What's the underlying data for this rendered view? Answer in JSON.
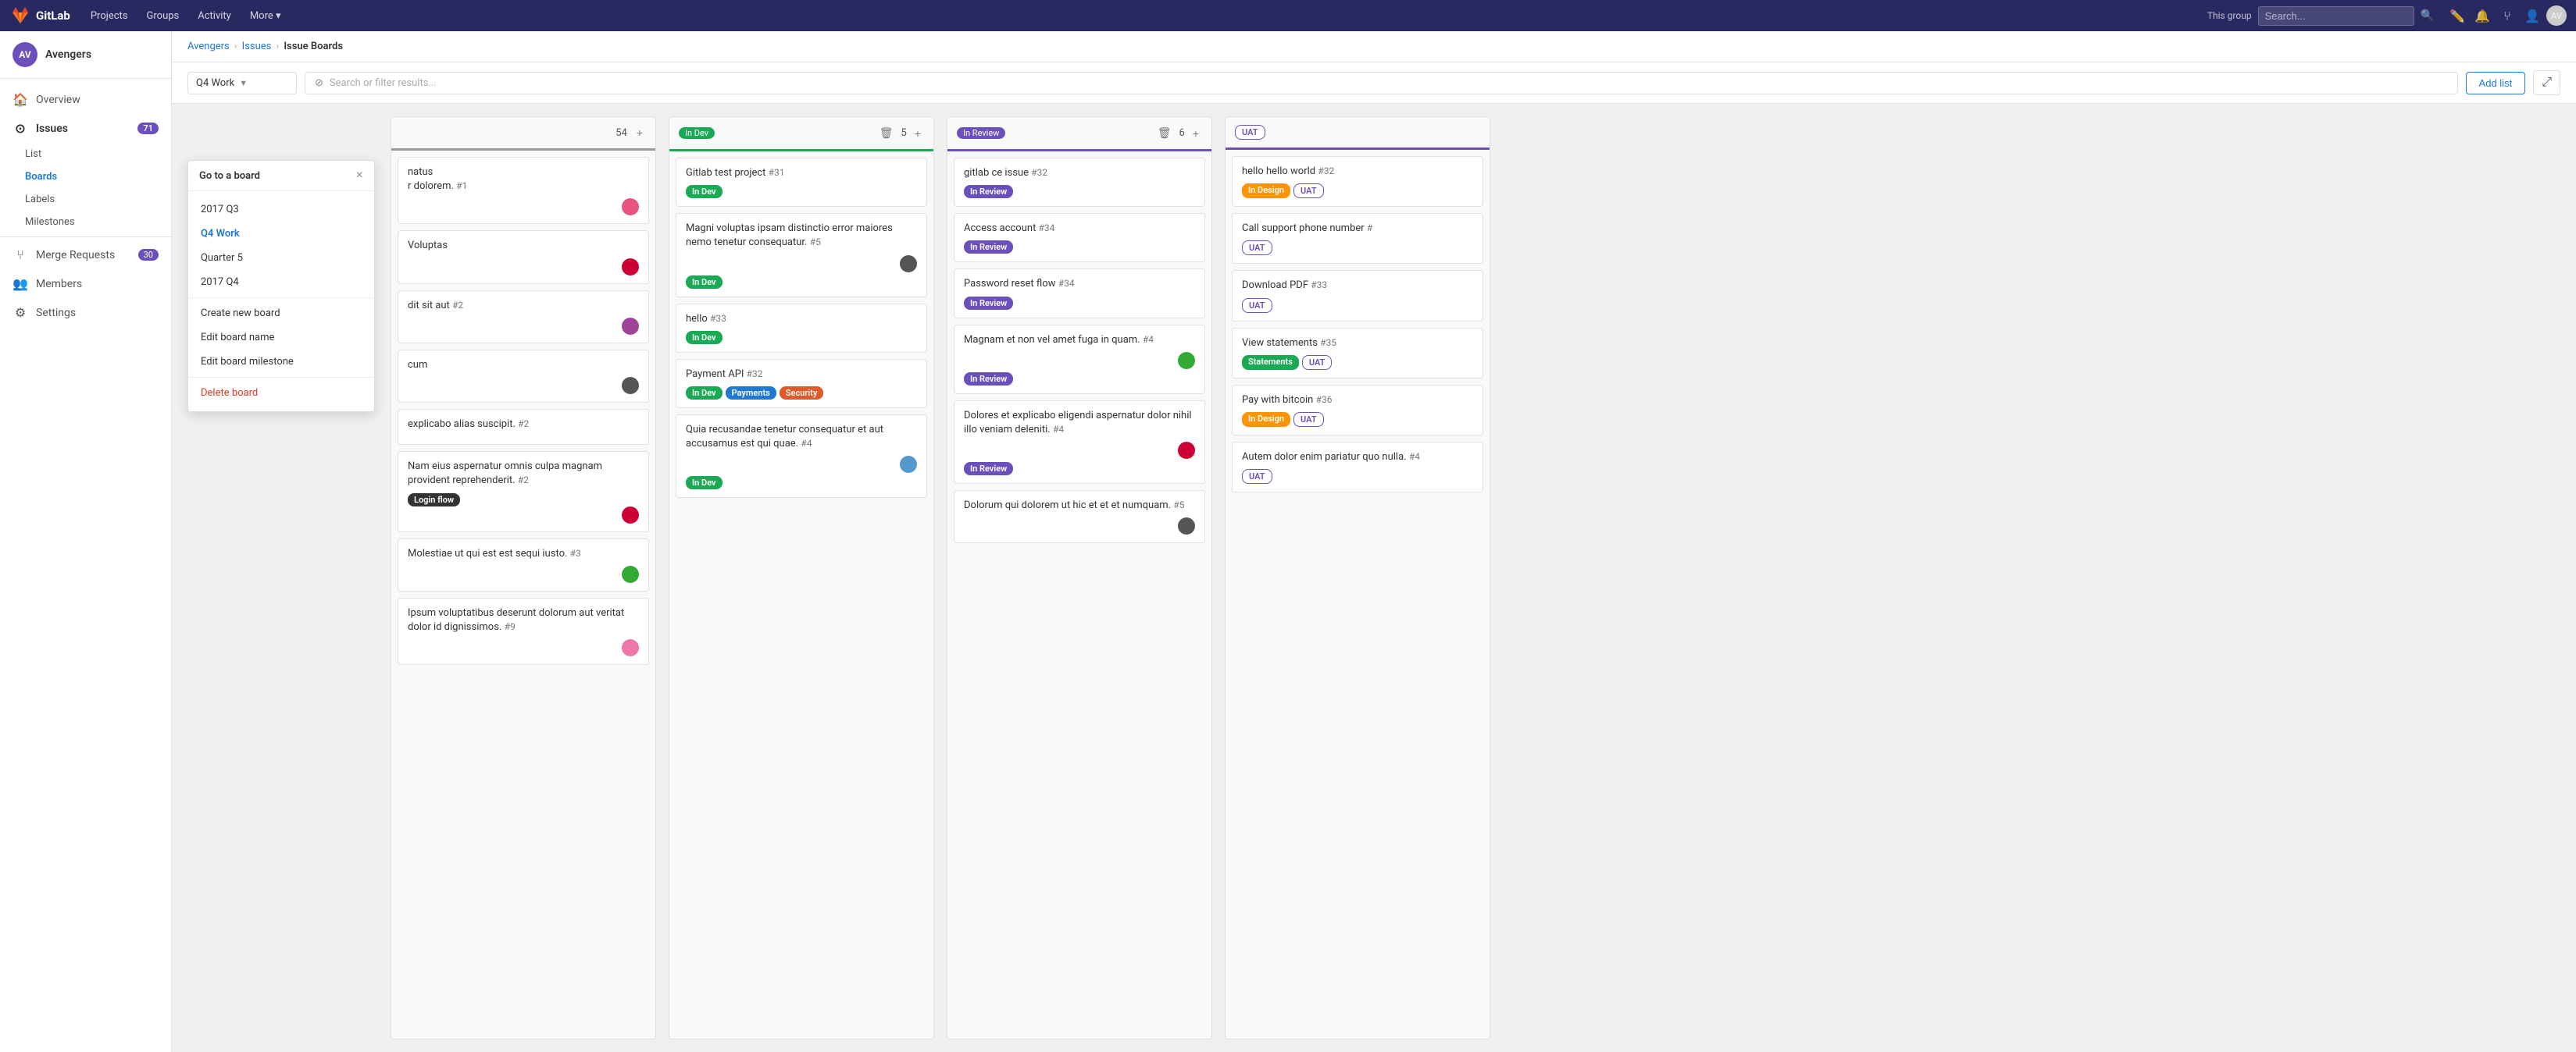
{
  "topNav": {
    "logoText": "GitLab",
    "links": [
      "Projects",
      "Groups",
      "Activity",
      "More ▾"
    ],
    "searchPlaceholder": "This group   Search...",
    "groupLabel": "This group"
  },
  "sidebar": {
    "groupName": "Avengers",
    "avatarInitials": "AV",
    "items": [
      {
        "id": "overview",
        "label": "Overview",
        "icon": "🏠",
        "badge": null
      },
      {
        "id": "issues",
        "label": "Issues",
        "icon": "⊙",
        "badge": "71"
      },
      {
        "id": "list",
        "label": "List",
        "icon": null,
        "sub": true
      },
      {
        "id": "boards",
        "label": "Boards",
        "icon": null,
        "sub": true,
        "active": true
      },
      {
        "id": "labels",
        "label": "Labels",
        "icon": null,
        "sub": true
      },
      {
        "id": "milestones",
        "label": "Milestones",
        "icon": null,
        "sub": true
      },
      {
        "id": "merge-requests",
        "label": "Merge Requests",
        "icon": "⑂",
        "badge": "30"
      },
      {
        "id": "members",
        "label": "Members",
        "icon": "👥",
        "badge": null
      },
      {
        "id": "settings",
        "label": "Settings",
        "icon": "⚙",
        "badge": null
      }
    ]
  },
  "breadcrumb": {
    "items": [
      "Avengers",
      "Issues",
      "Issue Boards"
    ]
  },
  "toolbar": {
    "boardSelect": "Q4 Work",
    "filterPlaceholder": "Search or filter results...",
    "addListLabel": "Add list",
    "fullscreenIcon": "⤢"
  },
  "dropdown": {
    "title": "Go to a board",
    "boards": [
      "2017 Q3",
      "Q4 Work",
      "Quarter 5",
      "2017 Q4"
    ],
    "activeBoard": "Q4 Work",
    "actions": [
      "Create new board",
      "Edit board name",
      "Edit board milestone",
      "Delete board"
    ]
  },
  "columns": [
    {
      "id": "partial",
      "label": "",
      "count": 54,
      "badgeType": "none",
      "cards": [
        {
          "title": "natus\nr dolorem.",
          "number": "#1",
          "labels": [],
          "avatarColor": "#e75480"
        },
        {
          "title": "Voluptas",
          "number": "",
          "labels": [],
          "avatarColor": "#e03"
        },
        {
          "title": "dit sit aut",
          "number": "#2",
          "labels": [],
          "avatarColor": "#a04"
        },
        {
          "title": "cum",
          "number": "",
          "labels": [],
          "avatarColor": "#555"
        },
        {
          "title": "explicabo alias suscipit.",
          "number": "#2",
          "labels": [],
          "avatarColor": null
        },
        {
          "title": "Nam eius aspernatur omnis culpa magnam provident reprehenderit.",
          "number": "#2",
          "labels": [
            "Login flow"
          ],
          "avatarColor": "#e03"
        },
        {
          "title": "Molestiae ut qui est est sequi iusto.",
          "number": "#3",
          "labels": [],
          "avatarColor": "#3a3"
        },
        {
          "title": "Ipsum voluptatibus deserunt dolorum aut veritat dolor id dignissimos.",
          "number": "#9",
          "labels": [],
          "avatarColor": "#e75"
        }
      ]
    },
    {
      "id": "in-dev",
      "label": "In Dev",
      "count": 5,
      "badgeType": "green",
      "cards": [
        {
          "title": "Gitlab test project",
          "number": "#31",
          "labels": [
            "In Dev"
          ],
          "avatarColor": null
        },
        {
          "title": "Magni voluptas ipsam distinctio error maiores nemo tenetur consequatur.",
          "number": "#5",
          "labels": [
            "In Dev"
          ],
          "avatarColor": "#555"
        },
        {
          "title": "hello",
          "number": "#33",
          "labels": [
            "In Dev"
          ],
          "avatarColor": null
        },
        {
          "title": "Payment API",
          "number": "#32",
          "labels": [
            "In Dev",
            "Payments",
            "Security"
          ],
          "avatarColor": null
        },
        {
          "title": "Quia recusandae tenetur consequatur et aut accusamus est qui quae.",
          "number": "#4",
          "labels": [
            "In Dev"
          ],
          "avatarColor": "#55a"
        }
      ]
    },
    {
      "id": "in-review",
      "label": "In Review",
      "count": 6,
      "badgeType": "purple",
      "cards": [
        {
          "title": "gitlab ce issue",
          "number": "#32",
          "labels": [
            "In Review"
          ],
          "avatarColor": null
        },
        {
          "title": "Access account",
          "number": "#34",
          "labels": [
            "In Review"
          ],
          "avatarColor": null
        },
        {
          "title": "Password reset flow",
          "number": "#34",
          "labels": [
            "In Review"
          ],
          "avatarColor": null
        },
        {
          "title": "Magnam et non vel amet fuga in quam.",
          "number": "#4",
          "labels": [
            "In Review"
          ],
          "avatarColor": "#3a3"
        },
        {
          "title": "Dolores et explicabo eligendi aspernatur dolor nihil illo veniam deleniti.",
          "number": "#4",
          "labels": [
            "In Review"
          ],
          "avatarColor": "#e03"
        },
        {
          "title": "Dolorum qui dolorem ut hic et et et numquam.",
          "number": "#5",
          "labels": [],
          "avatarColor": "#555"
        }
      ]
    },
    {
      "id": "uat",
      "label": "UAT",
      "count": null,
      "badgeType": "uat",
      "cards": [
        {
          "title": "hello hello world",
          "number": "#32",
          "labels": [
            "In Design",
            "UAT"
          ],
          "avatarColor": null
        },
        {
          "title": "Call support phone number",
          "number": "#",
          "labels": [
            "UAT"
          ],
          "avatarColor": null
        },
        {
          "title": "Download PDF",
          "number": "#33",
          "labels": [
            "UAT"
          ],
          "avatarColor": null
        },
        {
          "title": "View statements",
          "number": "#35",
          "labels": [
            "Statements",
            "UAT"
          ],
          "avatarColor": null
        },
        {
          "title": "Pay with bitcoin",
          "number": "#36",
          "labels": [
            "In Design",
            "UAT"
          ],
          "avatarColor": null
        },
        {
          "title": "Autem dolor enim pariatur quo nulla.",
          "number": "#4",
          "labels": [
            "UAT"
          ],
          "avatarColor": null
        }
      ]
    }
  ]
}
